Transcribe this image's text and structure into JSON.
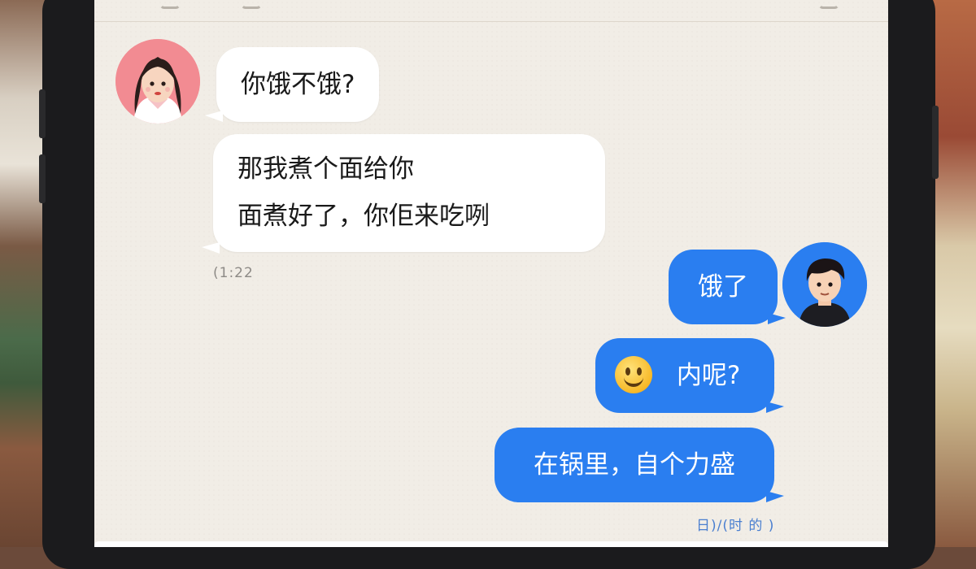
{
  "chat": {
    "messages": [
      {
        "sender": "contact",
        "text": "你饿不饿?"
      },
      {
        "sender": "contact",
        "lines": [
          "那我煮个面给你",
          "面煮好了，你佢来吃咧"
        ]
      },
      {
        "sender": "me",
        "text": "饿了"
      },
      {
        "sender": "me",
        "emoji": "smiley-face",
        "text": "内呢?"
      },
      {
        "sender": "me",
        "text": "在锅里，自个力盛"
      }
    ],
    "timestamps": {
      "contact": "(1:22",
      "me": "日)/(时 的 )"
    }
  },
  "avatars": {
    "contact": {
      "description_icon": "girl-avatar-icon",
      "bg_color": "#f28b92"
    },
    "me": {
      "description_icon": "boy-avatar-icon",
      "bg_color": "#2a7ef0"
    }
  },
  "colors": {
    "incoming_bubble": "#ffffff",
    "outgoing_bubble": "#2a7ef0",
    "screen_background": "#f1ede6"
  }
}
